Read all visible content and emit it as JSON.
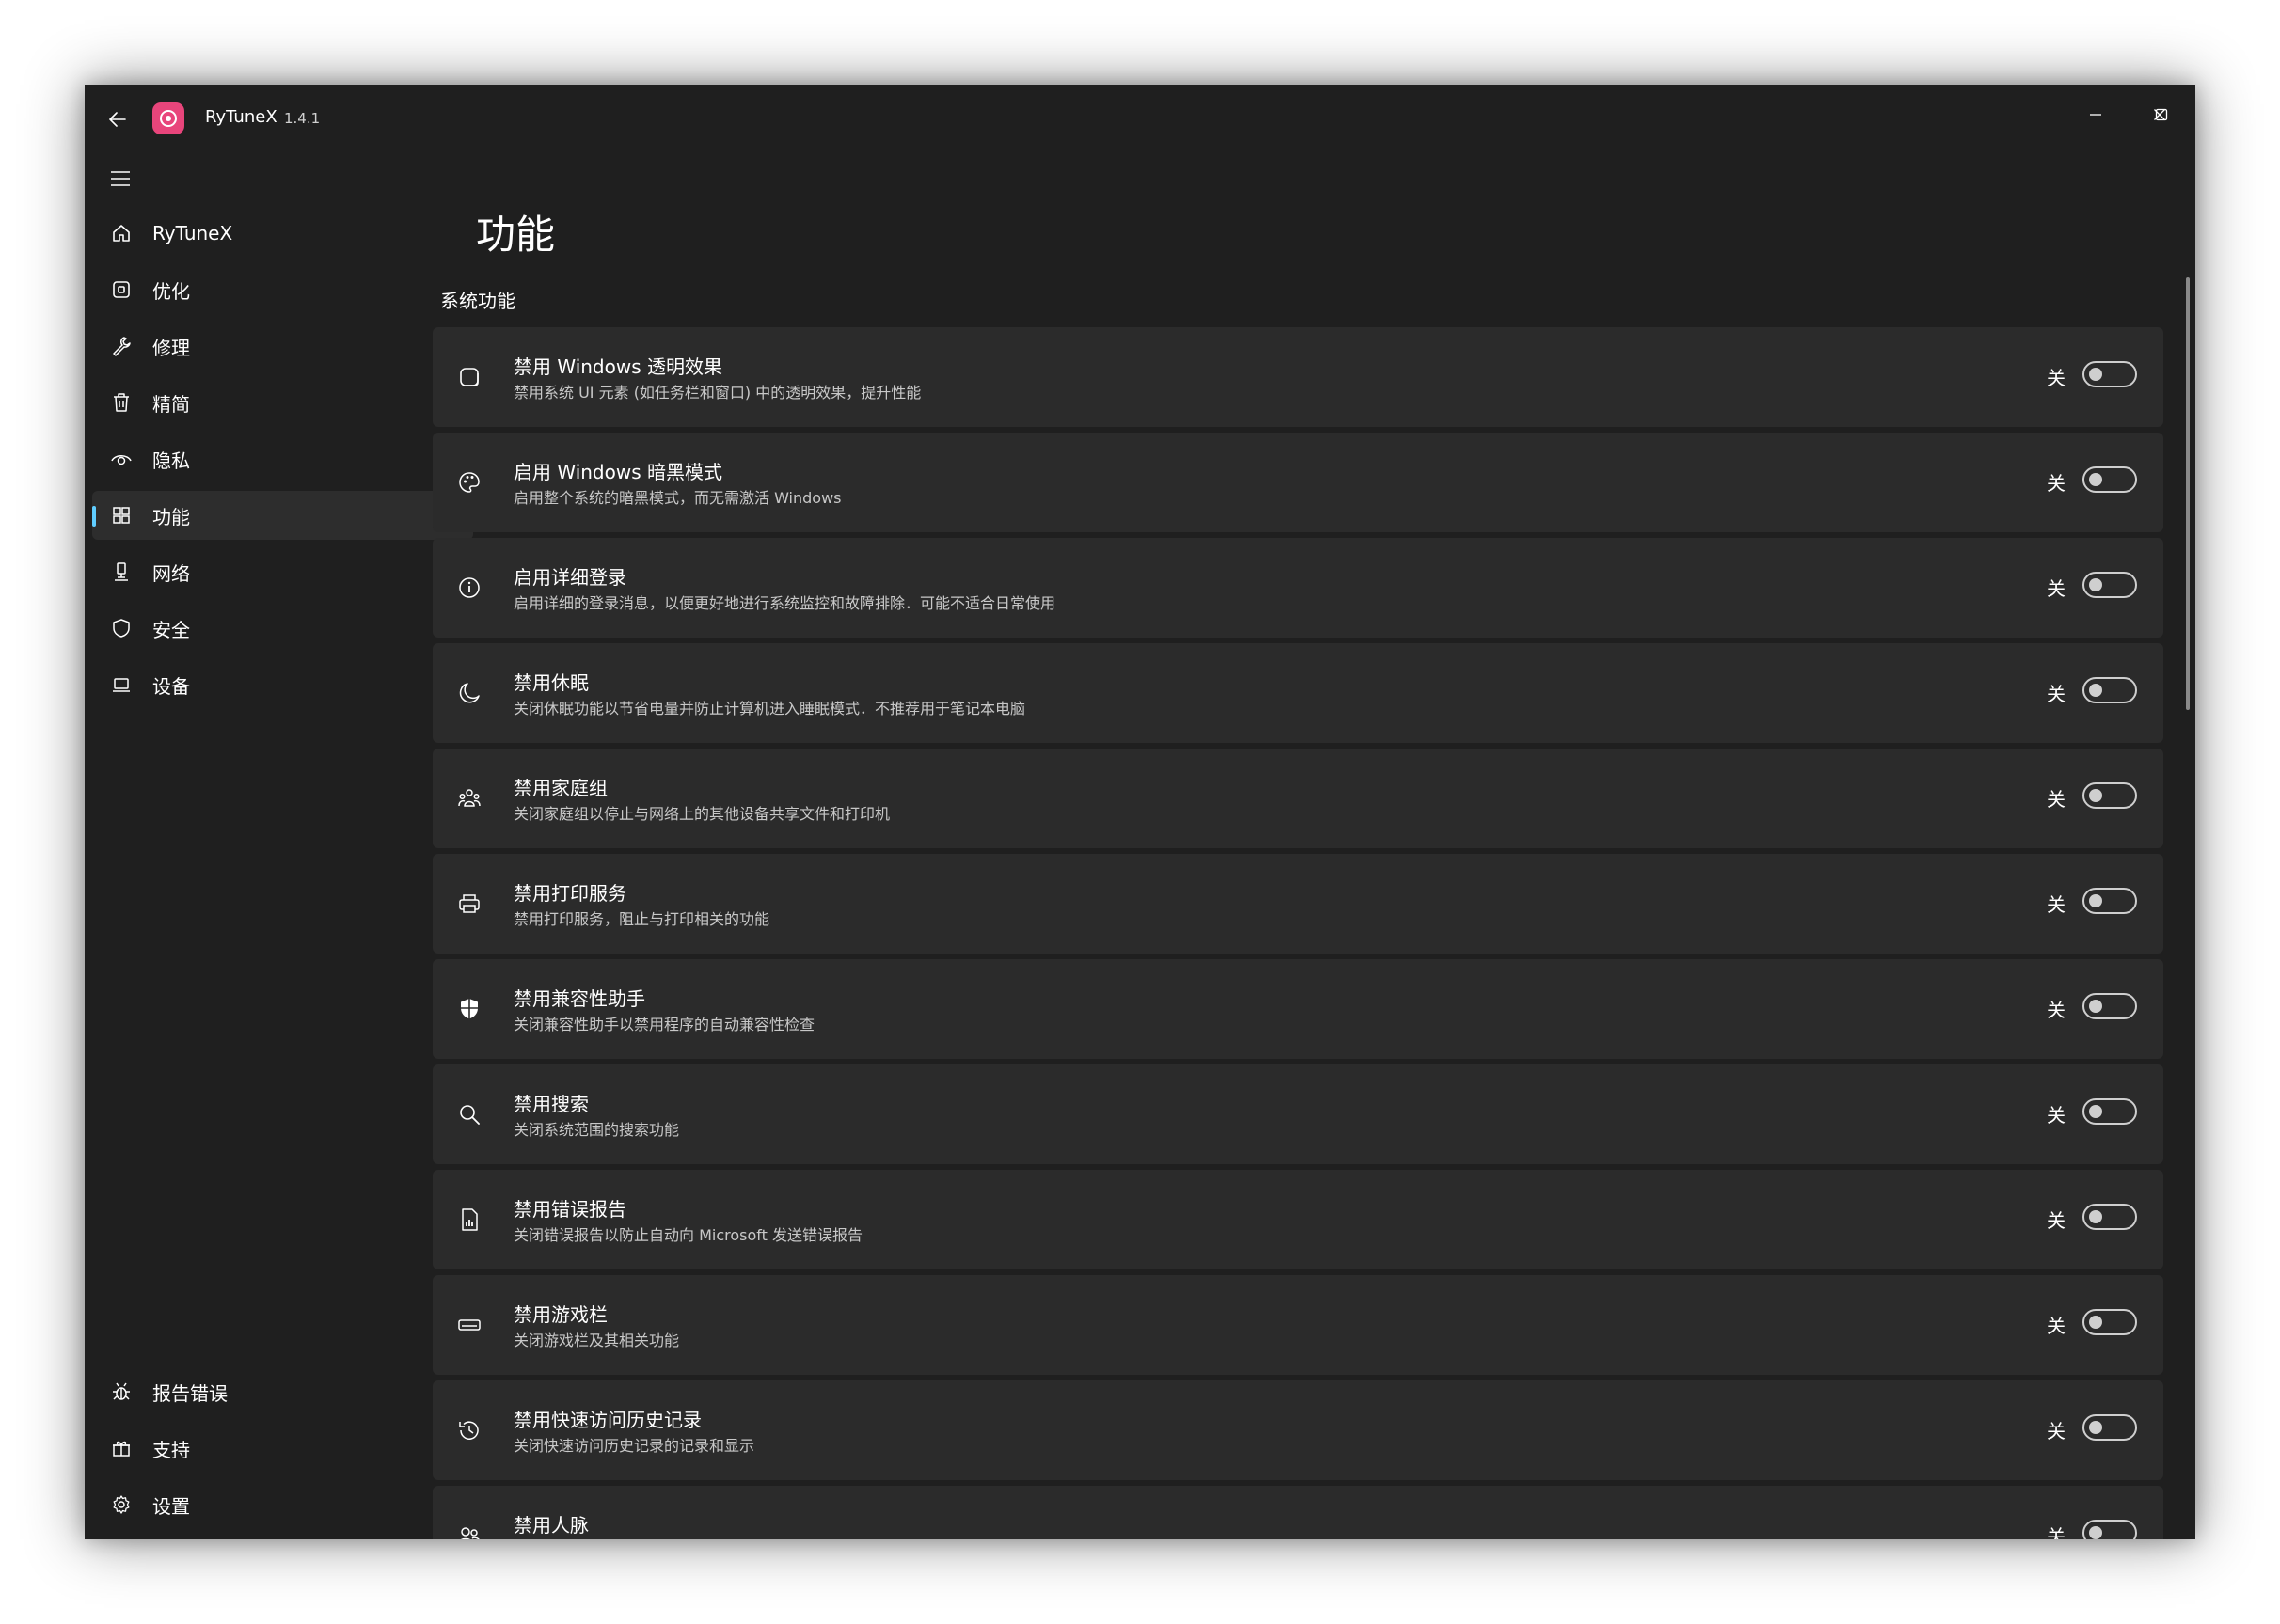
{
  "titlebar": {
    "app_name": "RyTuneX",
    "version": "1.4.1"
  },
  "sidebar": {
    "items": [
      {
        "label": "RyTuneX",
        "icon": "home-icon"
      },
      {
        "label": "优化",
        "icon": "optimize-icon"
      },
      {
        "label": "修理",
        "icon": "wrench-icon"
      },
      {
        "label": "精简",
        "icon": "trash-icon"
      },
      {
        "label": "隐私",
        "icon": "eye-icon"
      },
      {
        "label": "功能",
        "icon": "features-icon",
        "active": true
      },
      {
        "label": "网络",
        "icon": "network-icon"
      },
      {
        "label": "安全",
        "icon": "shield-icon"
      },
      {
        "label": "设备",
        "icon": "laptop-icon"
      }
    ],
    "footer_items": [
      {
        "label": "报告错误",
        "icon": "bug-icon"
      },
      {
        "label": "支持",
        "icon": "gift-icon"
      },
      {
        "label": "设置",
        "icon": "gear-icon"
      }
    ]
  },
  "main": {
    "page_title": "功能",
    "section_title": "系统功能",
    "features": [
      {
        "title": "禁用 Windows 透明效果",
        "desc": "禁用系统 UI 元素 (如任务栏和窗口) 中的透明效果，提升性能",
        "state": "关",
        "on": false,
        "icon": "transparency-icon"
      },
      {
        "title": "启用 Windows 暗黑模式",
        "desc": "启用整个系统的暗黑模式，而无需激活 Windows",
        "state": "关",
        "on": false,
        "icon": "palette-icon"
      },
      {
        "title": "启用详细登录",
        "desc": "启用详细的登录消息，以便更好地进行系统监控和故障排除．可能不适合日常使用",
        "state": "关",
        "on": false,
        "icon": "info-icon"
      },
      {
        "title": "禁用休眠",
        "desc": "关闭休眠功能以节省电量并防止计算机进入睡眠模式．不推荐用于笔记本电脑",
        "state": "关",
        "on": false,
        "icon": "moon-icon"
      },
      {
        "title": "禁用家庭组",
        "desc": "关闭家庭组以停止与网络上的其他设备共享文件和打印机",
        "state": "关",
        "on": false,
        "icon": "homegroup-icon"
      },
      {
        "title": "禁用打印服务",
        "desc": "禁用打印服务，阻止与打印相关的功能",
        "state": "关",
        "on": false,
        "icon": "printer-icon"
      },
      {
        "title": "禁用兼容性助手",
        "desc": "关闭兼容性助手以禁用程序的自动兼容性检查",
        "state": "关",
        "on": false,
        "icon": "shield-filled-icon"
      },
      {
        "title": "禁用搜索",
        "desc": "关闭系统范围的搜索功能",
        "state": "关",
        "on": false,
        "icon": "search-icon"
      },
      {
        "title": "禁用错误报告",
        "desc": "关闭错误报告以防止自动向 Microsoft 发送错误报告",
        "state": "关",
        "on": false,
        "icon": "report-icon"
      },
      {
        "title": "禁用游戏栏",
        "desc": "关闭游戏栏及其相关功能",
        "state": "关",
        "on": false,
        "icon": "gamebar-icon"
      },
      {
        "title": "禁用快速访问历史记录",
        "desc": "关闭快速访问历史记录的记录和显示",
        "state": "关",
        "on": false,
        "icon": "history-icon"
      },
      {
        "title": "禁用人脉",
        "desc": "",
        "state": "关",
        "on": false,
        "icon": "people-icon"
      }
    ]
  },
  "colors": {
    "window_bg": "#1f1f1f",
    "card_bg": "#2b2b2b",
    "accent": "#60cdff",
    "logo": "#e8457b"
  }
}
